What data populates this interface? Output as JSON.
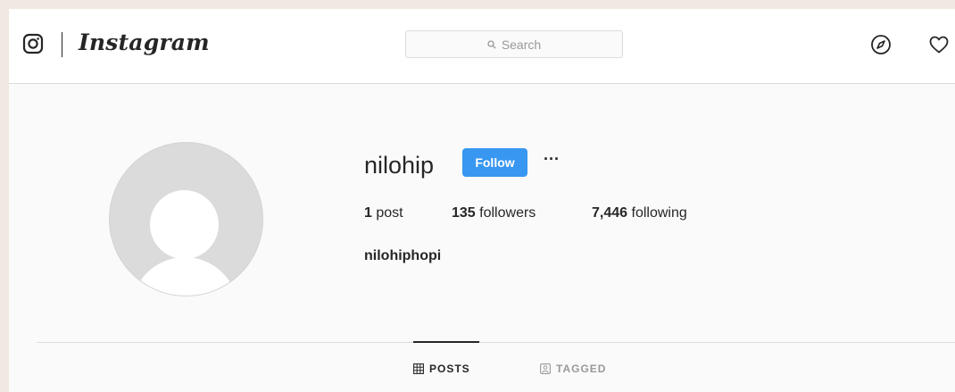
{
  "header": {
    "logo_text": "Instagram",
    "search_placeholder": "Search",
    "icons": [
      "instagram-glyph-icon",
      "explore-compass-icon",
      "activity-heart-icon"
    ]
  },
  "profile": {
    "username": "nilohip",
    "follow_label": "Follow",
    "more_label": "···",
    "stats": {
      "posts_count": "1",
      "posts_label": "post",
      "followers_count": "135",
      "followers_label": "followers",
      "following_count": "7,446",
      "following_label": "following"
    },
    "full_name": "nilohiphopi"
  },
  "tabs": [
    {
      "label": "POSTS",
      "active": true
    },
    {
      "label": "TAGGED",
      "active": false
    }
  ],
  "colors": {
    "accent": "#3897f0",
    "text": "#262626",
    "muted": "#999999"
  }
}
